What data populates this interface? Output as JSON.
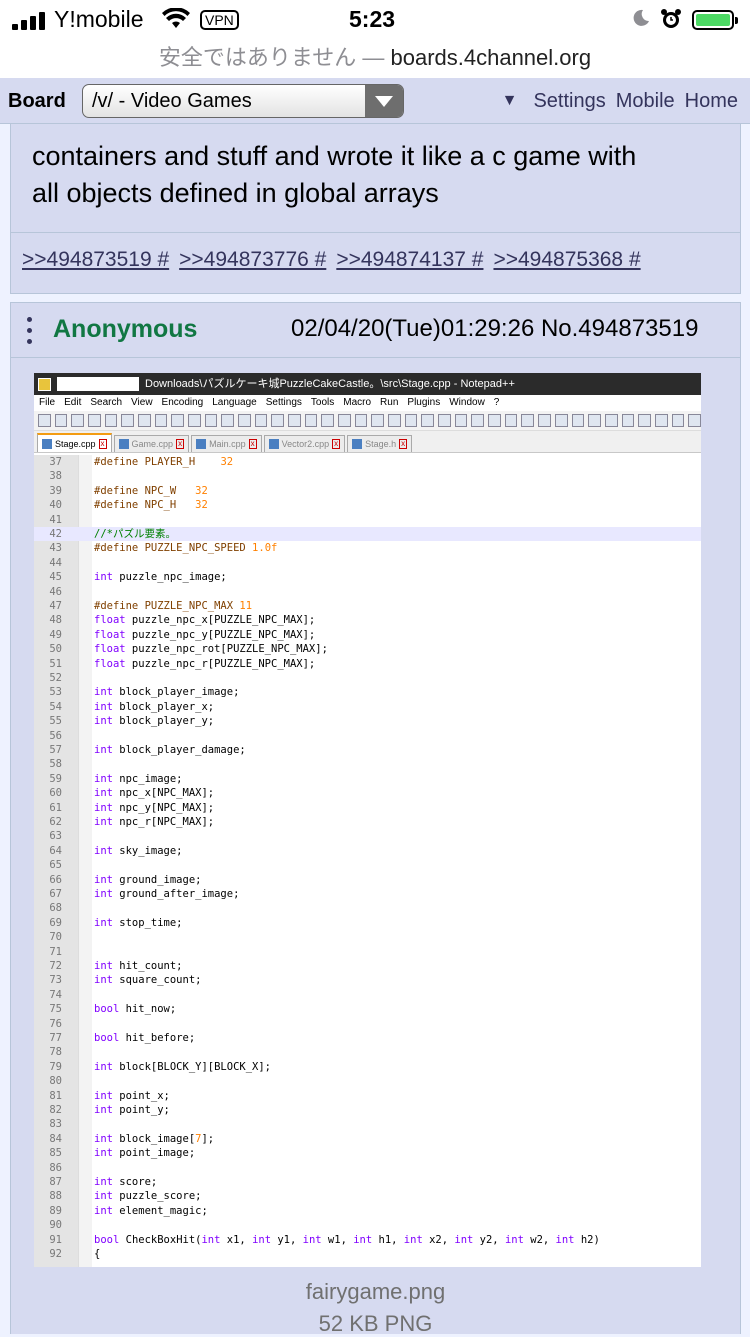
{
  "status_bar": {
    "carrier": "Y!mobile",
    "vpn": "VPN",
    "time": "5:23"
  },
  "url_bar": {
    "insecure_label": "安全ではありません",
    "separator": " — ",
    "domain": "boards.4channel.org"
  },
  "nav": {
    "board_label": "Board",
    "board_select": "/v/ - Video Games",
    "settings": "Settings",
    "mobile": "Mobile",
    "home": "Home"
  },
  "post_prev": {
    "message_line1": "containers and stuff and wrote it like a c game with",
    "message_line2": "all objects defined in global arrays",
    "backlinks": [
      ">>494873519 #",
      ">>494873776 #",
      ">>494874137 #",
      ">>494875368 #"
    ]
  },
  "post": {
    "name": "Anonymous",
    "datetime": "02/04/20(Tue)01:29:26 No.494873519",
    "file_name": "fairygame.png",
    "file_info": "52 KB PNG"
  },
  "notepad": {
    "title": "Downloads\\パズルケーキ城PuzzleCakeCastle。\\src\\Stage.cpp - Notepad++",
    "menu": [
      "File",
      "Edit",
      "Search",
      "View",
      "Encoding",
      "Language",
      "Settings",
      "Tools",
      "Macro",
      "Run",
      "Plugins",
      "Window",
      "?"
    ],
    "tabs": [
      "Stage.cpp",
      "Game.cpp",
      "Main.cpp",
      "Vector2.cpp",
      "Stage.h"
    ],
    "lines": [
      {
        "n": "37",
        "t": "#define PLAYER_H    32",
        "c": "pp"
      },
      {
        "n": "38",
        "t": "",
        "c": ""
      },
      {
        "n": "39",
        "t": "#define NPC_W   32",
        "c": "pp"
      },
      {
        "n": "40",
        "t": "#define NPC_H   32",
        "c": "pp"
      },
      {
        "n": "41",
        "t": "",
        "c": ""
      },
      {
        "n": "42",
        "t": "//*パズル要素。",
        "c": "cm"
      },
      {
        "n": "43",
        "t": "#define PUZZLE_NPC_SPEED 1.0f",
        "c": "pp"
      },
      {
        "n": "44",
        "t": "",
        "c": ""
      },
      {
        "n": "45",
        "t": "int puzzle_npc_image;",
        "c": "decl"
      },
      {
        "n": "46",
        "t": "",
        "c": ""
      },
      {
        "n": "47",
        "t": "#define PUZZLE_NPC_MAX 11",
        "c": "pp"
      },
      {
        "n": "48",
        "t": "float puzzle_npc_x[PUZZLE_NPC_MAX];",
        "c": "decl"
      },
      {
        "n": "49",
        "t": "float puzzle_npc_y[PUZZLE_NPC_MAX];",
        "c": "decl"
      },
      {
        "n": "50",
        "t": "float puzzle_npc_rot[PUZZLE_NPC_MAX];",
        "c": "decl"
      },
      {
        "n": "51",
        "t": "float puzzle_npc_r[PUZZLE_NPC_MAX];",
        "c": "decl"
      },
      {
        "n": "52",
        "t": "",
        "c": ""
      },
      {
        "n": "53",
        "t": "int block_player_image;",
        "c": "decl"
      },
      {
        "n": "54",
        "t": "int block_player_x;",
        "c": "decl"
      },
      {
        "n": "55",
        "t": "int block_player_y;",
        "c": "decl"
      },
      {
        "n": "56",
        "t": "",
        "c": ""
      },
      {
        "n": "57",
        "t": "int block_player_damage;",
        "c": "decl"
      },
      {
        "n": "58",
        "t": "",
        "c": ""
      },
      {
        "n": "59",
        "t": "int npc_image;",
        "c": "decl"
      },
      {
        "n": "60",
        "t": "int npc_x[NPC_MAX];",
        "c": "decl"
      },
      {
        "n": "61",
        "t": "int npc_y[NPC_MAX];",
        "c": "decl"
      },
      {
        "n": "62",
        "t": "int npc_r[NPC_MAX];",
        "c": "decl"
      },
      {
        "n": "63",
        "t": "",
        "c": ""
      },
      {
        "n": "64",
        "t": "int sky_image;",
        "c": "decl"
      },
      {
        "n": "65",
        "t": "",
        "c": ""
      },
      {
        "n": "66",
        "t": "int ground_image;",
        "c": "decl"
      },
      {
        "n": "67",
        "t": "int ground_after_image;",
        "c": "decl"
      },
      {
        "n": "68",
        "t": "",
        "c": ""
      },
      {
        "n": "69",
        "t": "int stop_time;",
        "c": "decl"
      },
      {
        "n": "70",
        "t": "",
        "c": ""
      },
      {
        "n": "71",
        "t": "",
        "c": ""
      },
      {
        "n": "72",
        "t": "int hit_count;",
        "c": "decl"
      },
      {
        "n": "73",
        "t": "int square_count;",
        "c": "decl"
      },
      {
        "n": "74",
        "t": "",
        "c": ""
      },
      {
        "n": "75",
        "t": "bool hit_now;",
        "c": "decl"
      },
      {
        "n": "76",
        "t": "",
        "c": ""
      },
      {
        "n": "77",
        "t": "bool hit_before;",
        "c": "decl"
      },
      {
        "n": "78",
        "t": "",
        "c": ""
      },
      {
        "n": "79",
        "t": "int block[BLOCK_Y][BLOCK_X];",
        "c": "decl"
      },
      {
        "n": "80",
        "t": "",
        "c": ""
      },
      {
        "n": "81",
        "t": "int point_x;",
        "c": "decl"
      },
      {
        "n": "82",
        "t": "int point_y;",
        "c": "decl"
      },
      {
        "n": "83",
        "t": "",
        "c": ""
      },
      {
        "n": "84",
        "t": "int block_image[7];",
        "c": "decl"
      },
      {
        "n": "85",
        "t": "int point_image;",
        "c": "decl"
      },
      {
        "n": "86",
        "t": "",
        "c": ""
      },
      {
        "n": "87",
        "t": "int score;",
        "c": "decl"
      },
      {
        "n": "88",
        "t": "int puzzle_score;",
        "c": "decl"
      },
      {
        "n": "89",
        "t": "int element_magic;",
        "c": "decl"
      },
      {
        "n": "90",
        "t": "",
        "c": ""
      },
      {
        "n": "91",
        "t": "bool CheckBoxHit(int x1, int y1, int w1, int h1, int x2, int y2, int w2, int h2)",
        "c": "decl"
      },
      {
        "n": "92",
        "t": "{",
        "c": ""
      }
    ]
  },
  "colors": {
    "post_bg": "#d6daf0",
    "border": "#b7c5d9",
    "name": "#117743",
    "link": "#34345c"
  }
}
